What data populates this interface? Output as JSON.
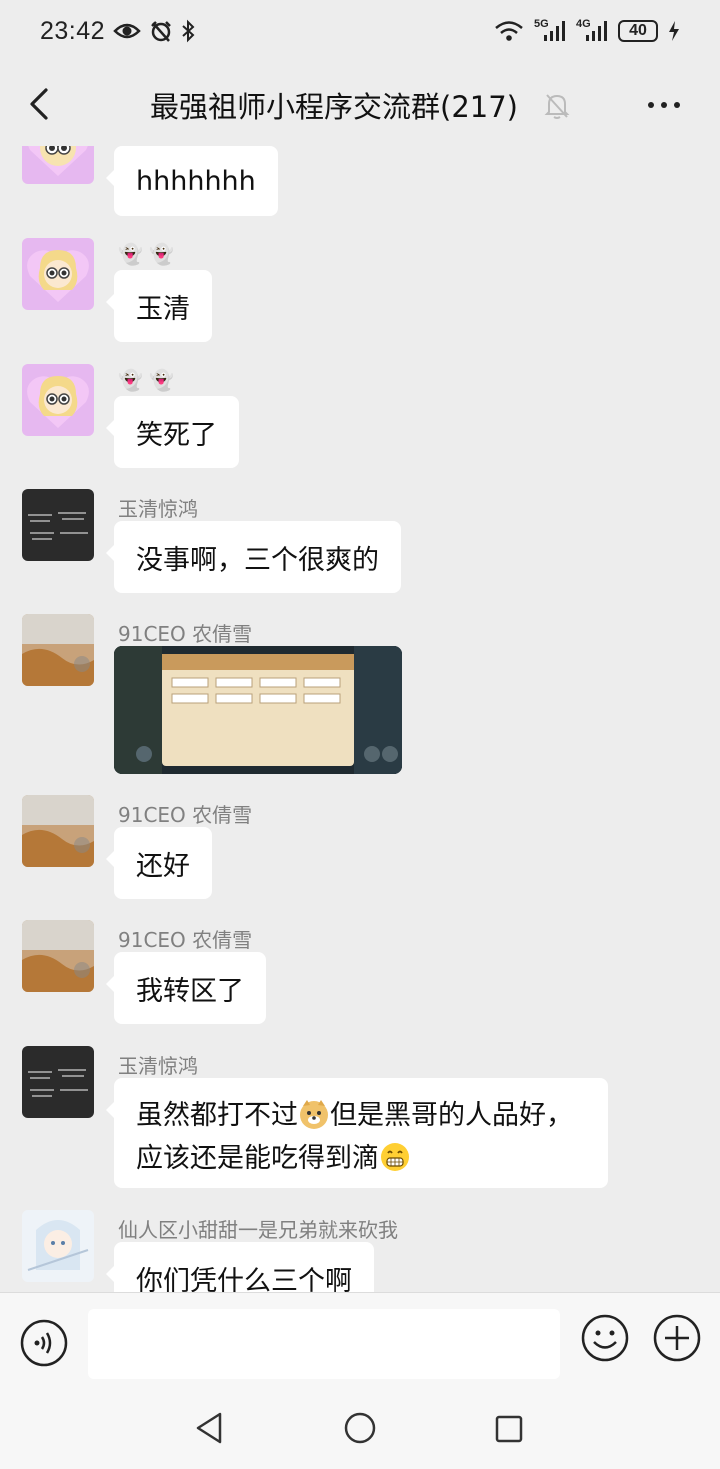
{
  "status_bar": {
    "time": "23:42",
    "network_5g": "5G",
    "network_4g": "4G",
    "battery": "40"
  },
  "header": {
    "title": "最强祖师小程序交流群(217)"
  },
  "messages": [
    {
      "sender": "",
      "text": "hhhhhhh"
    },
    {
      "sender": "👻 👻",
      "text": "玉清"
    },
    {
      "sender": "👻 👻",
      "text": "笑死了"
    },
    {
      "sender": "玉清惊鸿",
      "text": "没事啊，三个很爽的"
    },
    {
      "sender": "91CEO 农倩雪",
      "text": ""
    },
    {
      "sender": "91CEO 农倩雪",
      "text": "还好"
    },
    {
      "sender": "91CEO 农倩雪",
      "text": "我转区了"
    },
    {
      "sender": "玉清惊鸿",
      "line1a": "虽然都打不过",
      "line1b": "但是黑哥的人品好，",
      "line2": "应该还是能吃得到滴"
    },
    {
      "sender": "仙人区小甜甜一是兄弟就来砍我",
      "text": "你们凭什么三个啊"
    }
  ],
  "input": {
    "value": "",
    "placeholder": ""
  },
  "colors": {
    "background": "#ededed",
    "bubble": "#ffffff",
    "sender_name": "#808080"
  }
}
